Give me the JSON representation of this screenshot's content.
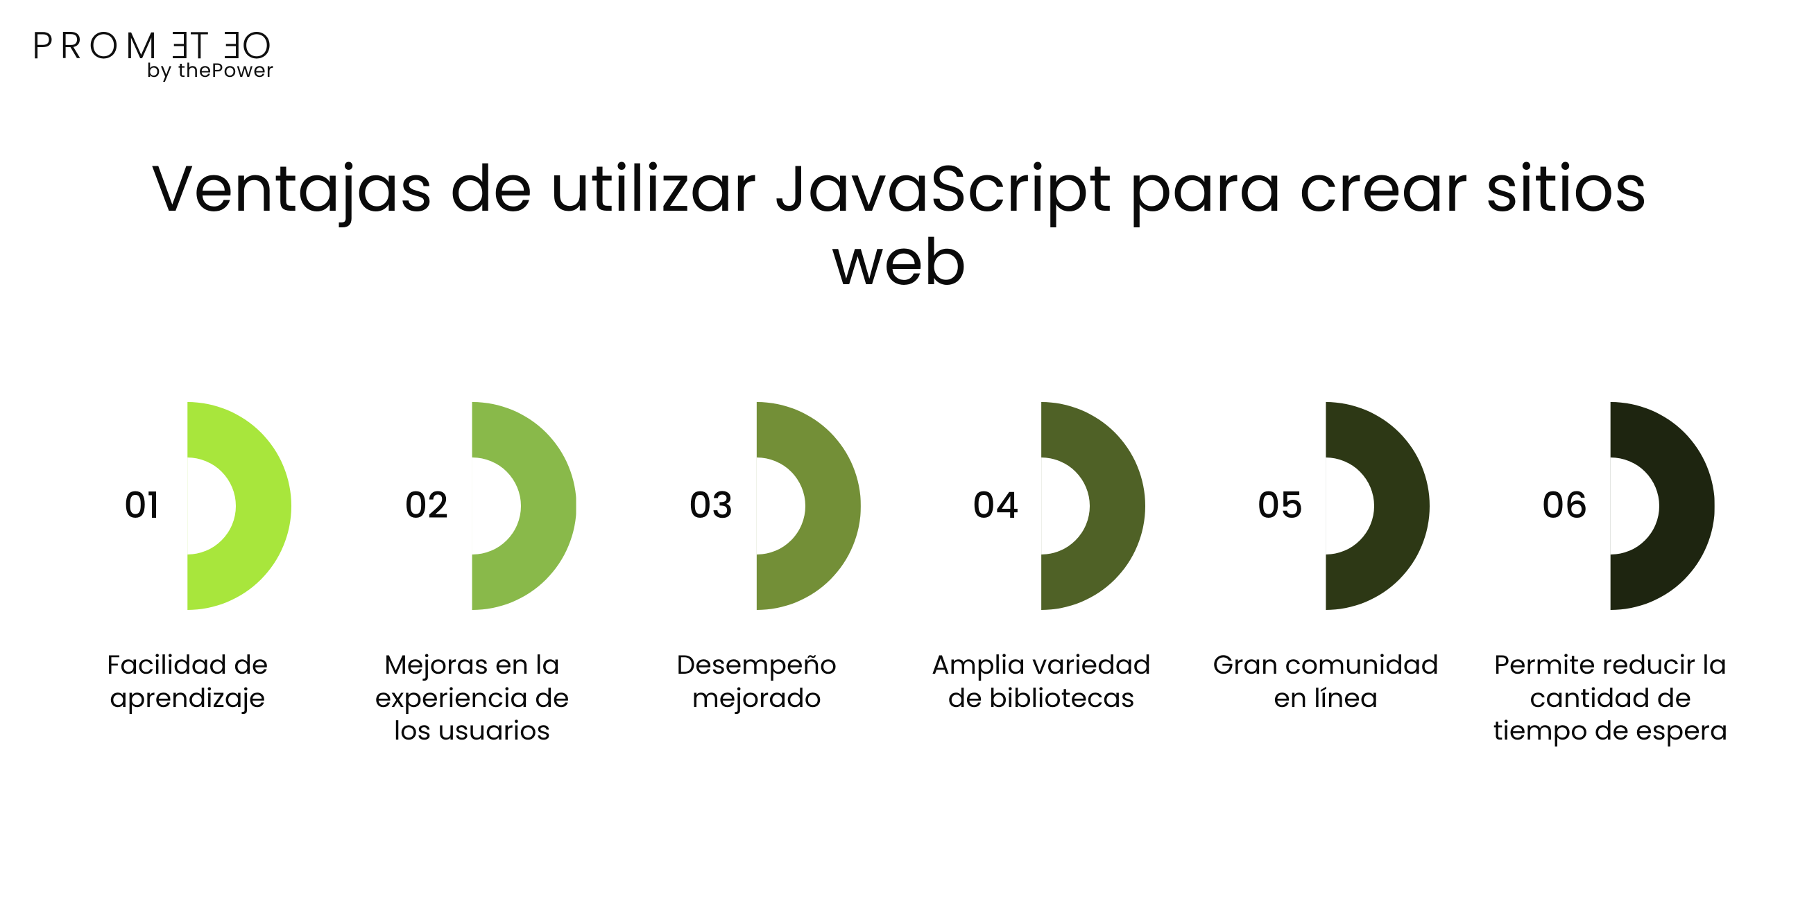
{
  "logo": {
    "main": "PROMETEO",
    "sub": "by thePower"
  },
  "title": "Ventajas de utilizar JavaScript para crear sitios web",
  "items": [
    {
      "num": "01",
      "label": "Facilidad de aprendizaje",
      "color": "#a8e63c"
    },
    {
      "num": "02",
      "label": "Mejoras en la experiencia de los usuarios",
      "color": "#89b94a"
    },
    {
      "num": "03",
      "label": "Desempeño mejorado",
      "color": "#738f37"
    },
    {
      "num": "04",
      "label": "Amplia variedad de bibliotecas",
      "color": "#4f6126"
    },
    {
      "num": "05",
      "label": "Gran comunidad en línea",
      "color": "#2d3815"
    },
    {
      "num": "06",
      "label": "Permite reducir la cantidad de tiempo de espera",
      "color": "#1e2510"
    }
  ]
}
